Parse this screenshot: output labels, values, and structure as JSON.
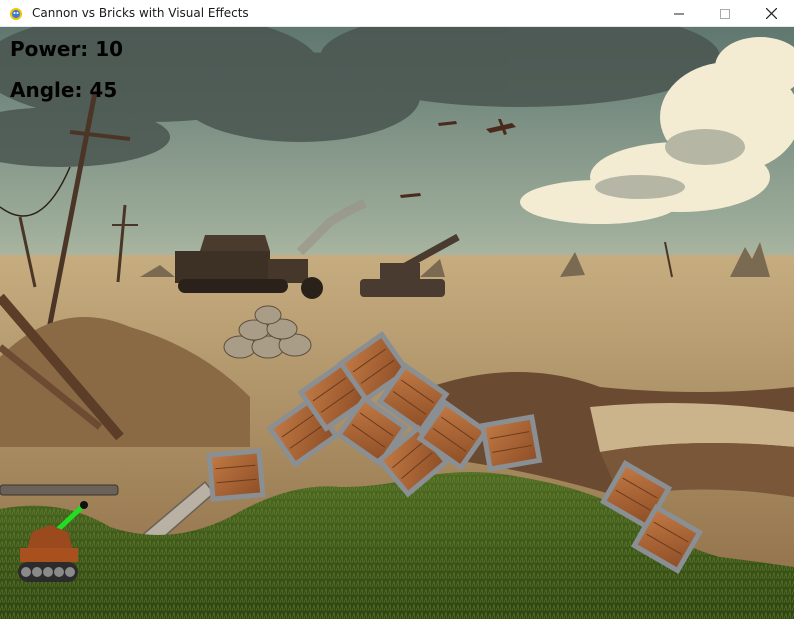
{
  "window": {
    "title": "Cannon vs Bricks with Visual Effects",
    "controls": [
      "minimize",
      "maximize",
      "close"
    ]
  },
  "hud": {
    "power_text": "Power: 10",
    "angle_text": "Angle: 45"
  },
  "colors": {
    "sky_top": "#6f8a7e",
    "sky_horizon": "#e7dcc0",
    "ground": "#a5895f",
    "grass": "#3f5a1c",
    "cannon_body": "#9a4a1c",
    "cannon_barrel": "#22dd22",
    "crate_wood": "#a8643a",
    "crate_metal": "#8a8f93"
  },
  "icons": [
    "pygame-snake-icon",
    "minimize-icon",
    "maximize-icon",
    "close-icon"
  ]
}
